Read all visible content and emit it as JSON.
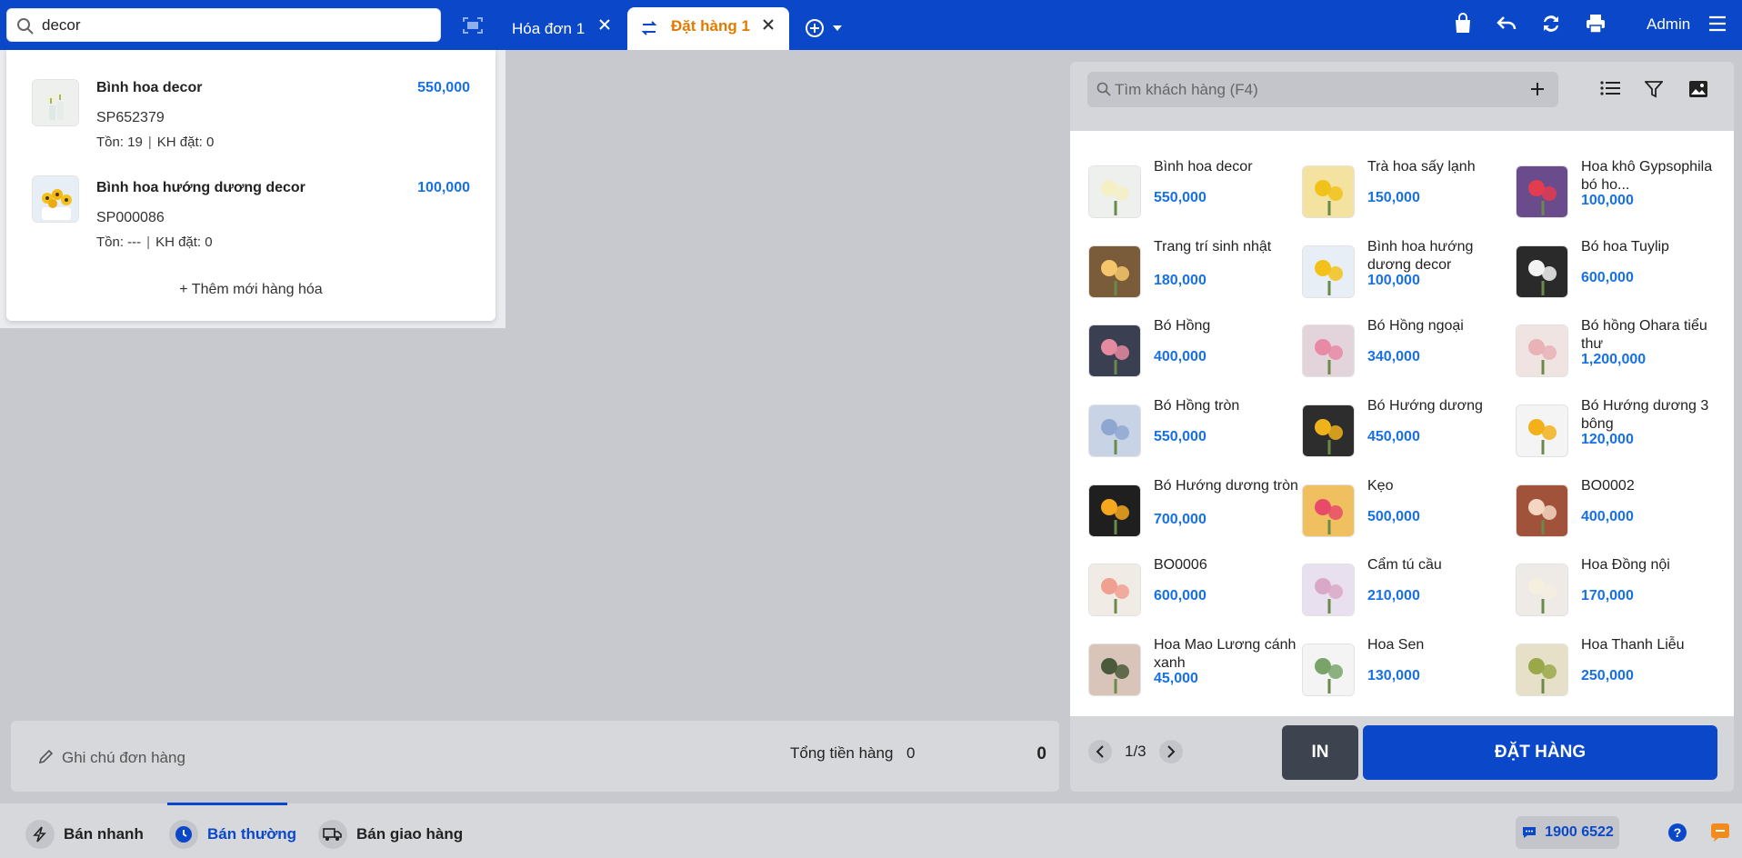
{
  "search": {
    "value": "decor"
  },
  "tabs": [
    {
      "label": "Hóa đơn 1"
    },
    {
      "label": "Đặt hàng 1"
    }
  ],
  "user": {
    "name": "Admin"
  },
  "dropdown": {
    "items": [
      {
        "name": "Bình hoa decor",
        "price": "550,000",
        "code": "SP652379",
        "stock": "Tồn: 19",
        "ordered": "KH đặt: 0"
      },
      {
        "name": "Bình hoa hướng dương decor",
        "price": "100,000",
        "code": "SP000086",
        "stock": "Tồn: ---",
        "ordered": "KH đặt: 0"
      }
    ],
    "add_new": "+ Thêm mới hàng hóa"
  },
  "order": {
    "note_placeholder": "Ghi chú đơn hàng",
    "total_label": "Tổng tiền hàng",
    "total_qty": "0",
    "total_value": "0"
  },
  "customer_search": {
    "placeholder": "Tìm khách hàng (F4)"
  },
  "products": [
    {
      "name": "Bình hoa decor",
      "price": "550,000"
    },
    {
      "name": "Trà hoa sấy lạnh",
      "price": "150,000"
    },
    {
      "name": "Hoa khô Gypsophila bó ho...",
      "price": "100,000"
    },
    {
      "name": "Trang trí sinh nhật",
      "price": "180,000"
    },
    {
      "name": "Bình hoa hướng dương decor",
      "price": "100,000"
    },
    {
      "name": "Bó hoa Tuylip",
      "price": "600,000"
    },
    {
      "name": "Bó Hồng",
      "price": "400,000"
    },
    {
      "name": "Bó Hồng ngoại",
      "price": "340,000"
    },
    {
      "name": "Bó hồng Ohara tiểu thư",
      "price": "1,200,000"
    },
    {
      "name": "Bó Hồng tròn",
      "price": "550,000"
    },
    {
      "name": "Bó Hướng dương",
      "price": "450,000"
    },
    {
      "name": "Bó Hướng dương 3 bông",
      "price": "120,000"
    },
    {
      "name": "Bó Hướng dương tròn",
      "price": "700,000"
    },
    {
      "name": "Kẹo",
      "price": "500,000"
    },
    {
      "name": "BO0002",
      "price": "400,000"
    },
    {
      "name": "BO0006",
      "price": "600,000"
    },
    {
      "name": "Cẩm tú cầu",
      "price": "210,000"
    },
    {
      "name": "Hoa Đồng nội",
      "price": "170,000"
    },
    {
      "name": "Hoa Mao Lương cánh xanh",
      "price": "45,000"
    },
    {
      "name": "Hoa Sen",
      "price": "130,000"
    },
    {
      "name": "Hoa Thanh Liễu",
      "price": "250,000"
    }
  ],
  "pager": {
    "text": "1/3"
  },
  "actions": {
    "print": "IN",
    "order": "ĐẶT HÀNG"
  },
  "bottom_nav": [
    {
      "label": "Bán nhanh"
    },
    {
      "label": "Bán thường"
    },
    {
      "label": "Bán giao hàng"
    }
  ],
  "hotline": "1900 6522",
  "colors": {
    "brand": "#0b48c9",
    "price": "#1770e6",
    "accent_tab": "#e07b00"
  }
}
